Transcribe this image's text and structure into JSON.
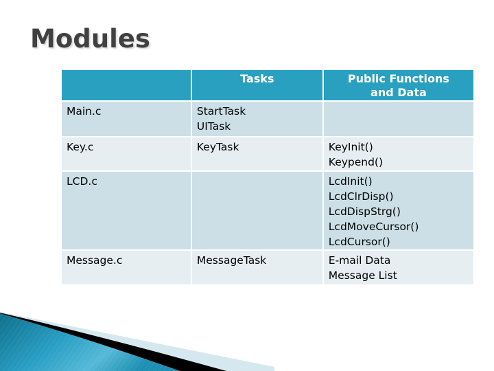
{
  "slide": {
    "title": "Modules"
  },
  "table": {
    "headers": [
      "",
      "Tasks",
      "Public Functions and Data"
    ],
    "header_lines": {
      "col3": [
        "Public Functions",
        "and Data"
      ]
    },
    "rows": [
      {
        "module": "Main.c",
        "tasks": [
          "StartTask",
          "UITask"
        ],
        "functions": []
      },
      {
        "module": "Key.c",
        "tasks": [
          "KeyTask"
        ],
        "functions": [
          "KeyInit()",
          "Keypend()"
        ]
      },
      {
        "module": "LCD.c",
        "tasks": [],
        "functions": [
          "LcdInit()",
          "LcdClrDisp()",
          "LcdDispStrg()",
          "LcdMoveCursor()",
          "LcdCursor()"
        ]
      },
      {
        "module": "Message.c",
        "tasks": [
          "MessageTask"
        ],
        "functions": [
          "E-mail Data",
          "Message List"
        ]
      }
    ]
  },
  "colors": {
    "header_bg": "#2aa0c0",
    "row_dark": "#ccdfe6",
    "row_light": "#e7eef2",
    "title_text": "#404040",
    "accent_swoosh": "#1a8fb0"
  }
}
